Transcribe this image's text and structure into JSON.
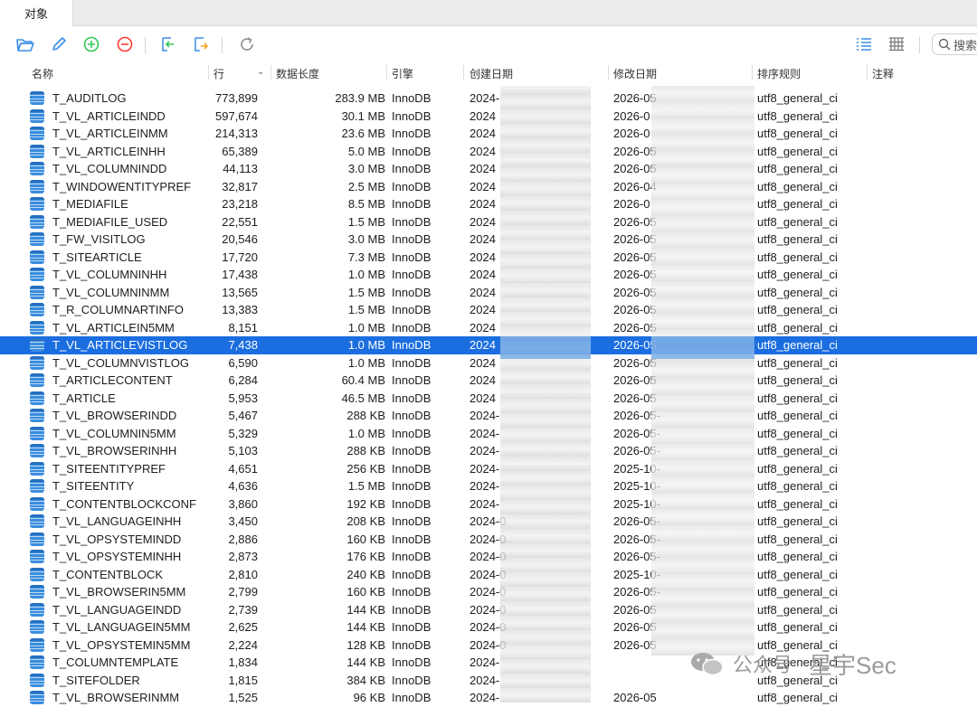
{
  "tab": {
    "label": "对象"
  },
  "search": {
    "placeholder": "搜索"
  },
  "columns": {
    "name": "名称",
    "rows": "行",
    "size": "数据长度",
    "engine": "引擎",
    "created": "创建日期",
    "modified": "修改日期",
    "collation": "排序规则",
    "comment": "注释"
  },
  "selected_row": "T_VL_ARTICLEVISTLOG",
  "tables": [
    {
      "name": "T_AUDITLOG",
      "rows": "773,899",
      "size": "283.9 MB",
      "engine": "InnoDB",
      "created": "2024-",
      "modified": "2026-05",
      "collation": "utf8_general_ci"
    },
    {
      "name": "T_VL_ARTICLEINDD",
      "rows": "597,674",
      "size": "30.1 MB",
      "engine": "InnoDB",
      "created": "2024",
      "modified": "2026-0",
      "collation": "utf8_general_ci"
    },
    {
      "name": "T_VL_ARTICLEINMM",
      "rows": "214,313",
      "size": "23.6 MB",
      "engine": "InnoDB",
      "created": "2024",
      "modified": "2026-0",
      "collation": "utf8_general_ci"
    },
    {
      "name": "T_VL_ARTICLEINHH",
      "rows": "65,389",
      "size": "5.0 MB",
      "engine": "InnoDB",
      "created": "2024",
      "modified": "2026-05",
      "collation": "utf8_general_ci"
    },
    {
      "name": "T_VL_COLUMNINDD",
      "rows": "44,113",
      "size": "3.0 MB",
      "engine": "InnoDB",
      "created": "2024",
      "modified": "2026-05",
      "collation": "utf8_general_ci"
    },
    {
      "name": "T_WINDOWENTITYPREF",
      "rows": "32,817",
      "size": "2.5 MB",
      "engine": "InnoDB",
      "created": "2024",
      "modified": "2026-04",
      "collation": "utf8_general_ci"
    },
    {
      "name": "T_MEDIAFILE",
      "rows": "23,218",
      "size": "8.5 MB",
      "engine": "InnoDB",
      "created": "2024",
      "modified": "2026-0",
      "collation": "utf8_general_ci"
    },
    {
      "name": "T_MEDIAFILE_USED",
      "rows": "22,551",
      "size": "1.5 MB",
      "engine": "InnoDB",
      "created": "2024",
      "modified": "2026-05",
      "collation": "utf8_general_ci"
    },
    {
      "name": "T_FW_VISITLOG",
      "rows": "20,546",
      "size": "3.0 MB",
      "engine": "InnoDB",
      "created": "2024",
      "modified": "2026-05",
      "collation": "utf8_general_ci"
    },
    {
      "name": "T_SITEARTICLE",
      "rows": "17,720",
      "size": "7.3 MB",
      "engine": "InnoDB",
      "created": "2024",
      "modified": "2026-05",
      "collation": "utf8_general_ci"
    },
    {
      "name": "T_VL_COLUMNINHH",
      "rows": "17,438",
      "size": "1.0 MB",
      "engine": "InnoDB",
      "created": "2024",
      "modified": "2026-05",
      "collation": "utf8_general_ci"
    },
    {
      "name": "T_VL_COLUMNINMM",
      "rows": "13,565",
      "size": "1.5 MB",
      "engine": "InnoDB",
      "created": "2024",
      "modified": "2026-05",
      "collation": "utf8_general_ci"
    },
    {
      "name": "T_R_COLUMNARTINFO",
      "rows": "13,383",
      "size": "1.5 MB",
      "engine": "InnoDB",
      "created": "2024",
      "modified": "2026-05",
      "collation": "utf8_general_ci"
    },
    {
      "name": "T_VL_ARTICLEIN5MM",
      "rows": "8,151",
      "size": "1.0 MB",
      "engine": "InnoDB",
      "created": "2024",
      "modified": "2026-05",
      "collation": "utf8_general_ci"
    },
    {
      "name": "T_VL_ARTICLEVISTLOG",
      "rows": "7,438",
      "size": "1.0 MB",
      "engine": "InnoDB",
      "created": "2024",
      "modified": "2026-05",
      "collation": "utf8_general_ci"
    },
    {
      "name": "T_VL_COLUMNVISTLOG",
      "rows": "6,590",
      "size": "1.0 MB",
      "engine": "InnoDB",
      "created": "2024",
      "modified": "2026-05",
      "collation": "utf8_general_ci"
    },
    {
      "name": "T_ARTICLECONTENT",
      "rows": "6,284",
      "size": "60.4 MB",
      "engine": "InnoDB",
      "created": "2024",
      "modified": "2026-05",
      "collation": "utf8_general_ci"
    },
    {
      "name": "T_ARTICLE",
      "rows": "5,953",
      "size": "46.5 MB",
      "engine": "InnoDB",
      "created": "2024",
      "modified": "2026-05",
      "collation": "utf8_general_ci"
    },
    {
      "name": "T_VL_BROWSERINDD",
      "rows": "5,467",
      "size": "288 KB",
      "engine": "InnoDB",
      "created": "2024-",
      "modified": "2026-05-",
      "collation": "utf8_general_ci"
    },
    {
      "name": "T_VL_COLUMNIN5MM",
      "rows": "5,329",
      "size": "1.0 MB",
      "engine": "InnoDB",
      "created": "2024-",
      "modified": "2026-05-",
      "collation": "utf8_general_ci"
    },
    {
      "name": "T_VL_BROWSERINHH",
      "rows": "5,103",
      "size": "288 KB",
      "engine": "InnoDB",
      "created": "2024-",
      "modified": "2026-05-",
      "collation": "utf8_general_ci"
    },
    {
      "name": "T_SITEENTITYPREF",
      "rows": "4,651",
      "size": "256 KB",
      "engine": "InnoDB",
      "created": "2024-",
      "modified": "2025-10-",
      "collation": "utf8_general_ci"
    },
    {
      "name": "T_SITEENTITY",
      "rows": "4,636",
      "size": "1.5 MB",
      "engine": "InnoDB",
      "created": "2024-",
      "modified": "2025-10-",
      "collation": "utf8_general_ci"
    },
    {
      "name": "T_CONTENTBLOCKCONF",
      "rows": "3,860",
      "size": "192 KB",
      "engine": "InnoDB",
      "created": "2024-",
      "modified": "2025-10-",
      "collation": "utf8_general_ci"
    },
    {
      "name": "T_VL_LANGUAGEINHH",
      "rows": "3,450",
      "size": "208 KB",
      "engine": "InnoDB",
      "created": "2024-0",
      "modified": "2026-05-",
      "collation": "utf8_general_ci"
    },
    {
      "name": "T_VL_OPSYSTEMINDD",
      "rows": "2,886",
      "size": "160 KB",
      "engine": "InnoDB",
      "created": "2024-0",
      "modified": "2026-05-",
      "collation": "utf8_general_ci"
    },
    {
      "name": "T_VL_OPSYSTEMINHH",
      "rows": "2,873",
      "size": "176 KB",
      "engine": "InnoDB",
      "created": "2024-0",
      "modified": "2026-05-",
      "collation": "utf8_general_ci"
    },
    {
      "name": "T_CONTENTBLOCK",
      "rows": "2,810",
      "size": "240 KB",
      "engine": "InnoDB",
      "created": "2024-0",
      "modified": "2025-10-",
      "collation": "utf8_general_ci"
    },
    {
      "name": "T_VL_BROWSERIN5MM",
      "rows": "2,799",
      "size": "160 KB",
      "engine": "InnoDB",
      "created": "2024-0",
      "modified": "2026-05-",
      "collation": "utf8_general_ci"
    },
    {
      "name": "T_VL_LANGUAGEINDD",
      "rows": "2,739",
      "size": "144 KB",
      "engine": "InnoDB",
      "created": "2024-0",
      "modified": "2026-05",
      "collation": "utf8_general_ci"
    },
    {
      "name": "T_VL_LANGUAGEIN5MM",
      "rows": "2,625",
      "size": "144 KB",
      "engine": "InnoDB",
      "created": "2024-0",
      "modified": "2026-05",
      "collation": "utf8_general_ci"
    },
    {
      "name": "T_VL_OPSYSTEMIN5MM",
      "rows": "2,224",
      "size": "128 KB",
      "engine": "InnoDB",
      "created": "2024-0",
      "modified": "2026-05",
      "collation": "utf8_general_ci"
    },
    {
      "name": "T_COLUMNTEMPLATE",
      "rows": "1,834",
      "size": "144 KB",
      "engine": "InnoDB",
      "created": "2024-",
      "modified": "",
      "collation": "utf8_general_ci"
    },
    {
      "name": "T_SITEFOLDER",
      "rows": "1,815",
      "size": "384 KB",
      "engine": "InnoDB",
      "created": "2024-",
      "modified": "",
      "collation": "utf8_general_ci"
    },
    {
      "name": "T_VL_BROWSERINMM",
      "rows": "1,525",
      "size": "96 KB",
      "engine": "InnoDB",
      "created": "2024-",
      "modified": "2026-05",
      "collation": "utf8_general_ci"
    }
  ],
  "watermark": {
    "account": "公众号",
    "brand": "星宇Sec"
  },
  "colors": {
    "selection": "#1b6ee0",
    "table_icon": "#3b8ddd",
    "toolbar_icon_blue": "#3a8ee6",
    "toolbar_icon_green": "#34c759",
    "toolbar_icon_red": "#ff3b30",
    "toolbar_icon_orange": "#f5a623"
  }
}
